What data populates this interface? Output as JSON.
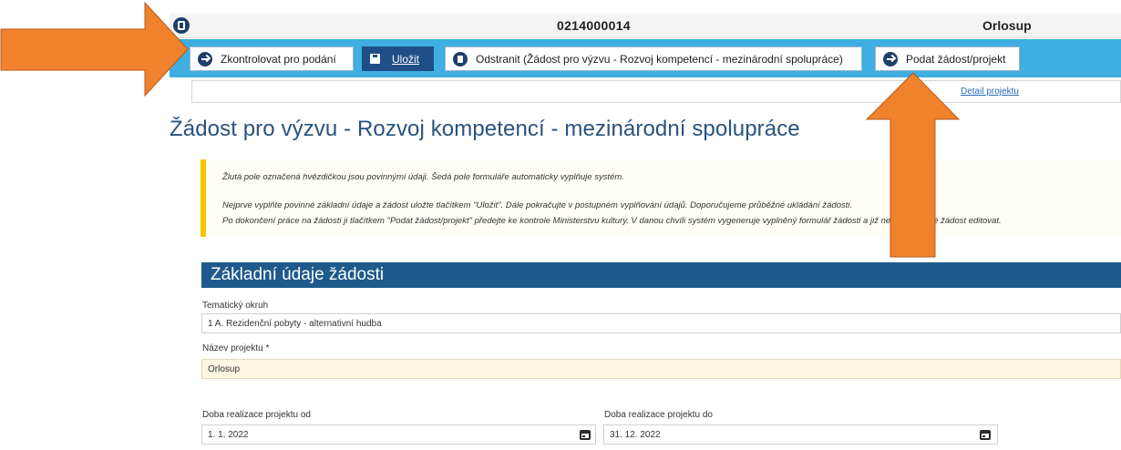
{
  "header": {
    "project_code": "0214000014",
    "applicant_name": "Orlosup"
  },
  "toolbar": {
    "check_label": "Zkontrolovat pro podání",
    "save_label": "Uložit",
    "delete_label": "Odstranit (Žádost pro výzvu - Rozvoj kompetencí - mezinárodní spolupráce)",
    "submit_label": "Podat žádost/projekt"
  },
  "detail_link": "Detail projektu",
  "page_title": "Žádost pro výzvu - Rozvoj kompetencí - mezinárodní spolupráce",
  "info": {
    "line1": "Žlutá pole označená hvězdičkou jsou povinnými údaji. Šedá pole formuláře automaticky vyplňuje systém.",
    "line2": "Nejprve vyplňte povinné základní údaje a žádost uložte tlačítkem \"Uložit\". Dále pokračujte v postupném vyplňování údajů. Doporučujeme průběžné ukládání žádosti.",
    "line3": "Po dokončení práce na žádosti ji tlačítkem \"Podat žádost/projekt\" předejte ke kontrole Ministerstvu kultury. V danou chvíli systém vygeneruje vyplněný formulář žádosti a již nebude možné žádost editovat."
  },
  "section_title": "Základní údaje žádosti",
  "fields": {
    "topic_label": "Tematický okruh",
    "topic_value": "1 A. Rezidenční pobyty - alternativní hudba",
    "name_label": "Název projektu *",
    "name_value": "Orlosup",
    "from_label": "Doba realizace projektu od",
    "from_value": "1. 1. 2022",
    "to_label": "Doba realizace projektu do",
    "to_value": "31. 12. 2022"
  },
  "colors": {
    "toolbar_bg": "#3eaee3",
    "section_bg": "#1e5a8c",
    "title_color": "#29527f",
    "info_accent": "#f5c500",
    "annotation_arrow": "#f0822e"
  },
  "icons": {
    "logo": "app-logo-icon",
    "check": "arrow-right-circle-icon",
    "save": "floppy-disk-icon",
    "delete": "trash-icon",
    "submit": "arrow-right-circle-icon",
    "calendar": "calendar-icon"
  }
}
